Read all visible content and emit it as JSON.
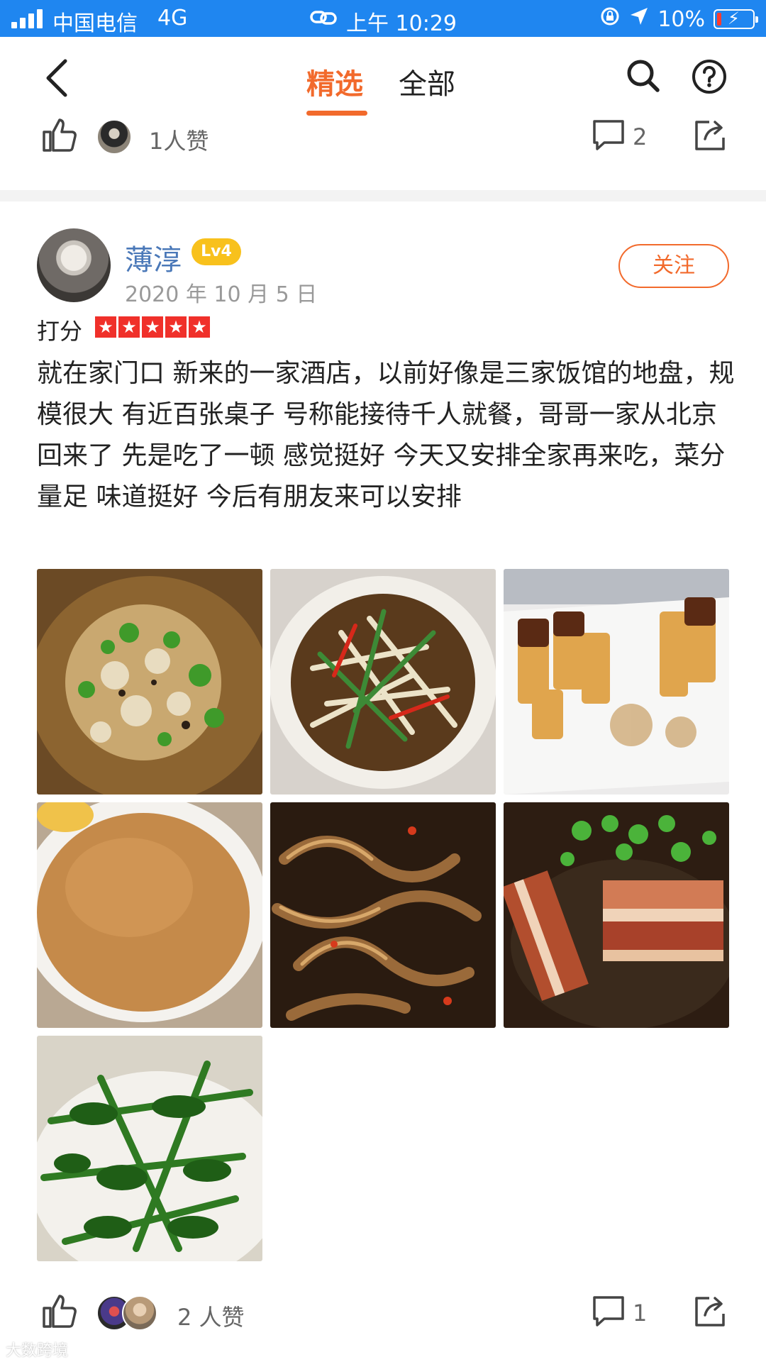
{
  "status_bar": {
    "carrier": "中国电信",
    "network": "4G",
    "time": "上午 10:29",
    "battery": "10%",
    "battery_level": 0.1
  },
  "nav": {
    "tabs": [
      {
        "label": "精选",
        "selected": true
      },
      {
        "label": "全部",
        "selected": false
      }
    ]
  },
  "top_actions": {
    "likes_text": "1人赞",
    "comment_count": "2"
  },
  "post": {
    "username": "薄淳",
    "level": "Lv4",
    "date": "2020 年 10 月 5 日",
    "follow_label": "关注",
    "rating_label": "打分",
    "rating_stars": 5,
    "text": "就在家门口 新来的一家酒店，以前好像是三家饭馆的地盘，规模很大 有近百张桌子 号称能接待千人就餐，哥哥一家从北京回来了 先是吃了一顿 感觉挺好 今天又安排全家再来吃，菜分量足 味道挺好 今后有朋友来可以安排",
    "photos": [
      {
        "icon": "food-photo-boiled-fish"
      },
      {
        "icon": "food-photo-stirfried-tofu-skin"
      },
      {
        "icon": "food-photo-fried-tofu"
      },
      {
        "icon": "food-photo-rice-dome"
      },
      {
        "icon": "food-photo-eel"
      },
      {
        "icon": "food-photo-braised-pork"
      },
      {
        "icon": "food-photo-greens"
      }
    ],
    "likes_text": "2 人赞",
    "comment_count": "1"
  },
  "watermark": "大数跨境",
  "colors": {
    "status_bar": "#1f86f0",
    "accent": "#f26a2c",
    "username": "#4a78b8",
    "level_badge": "#f8c11c",
    "star": "#f0302a"
  }
}
